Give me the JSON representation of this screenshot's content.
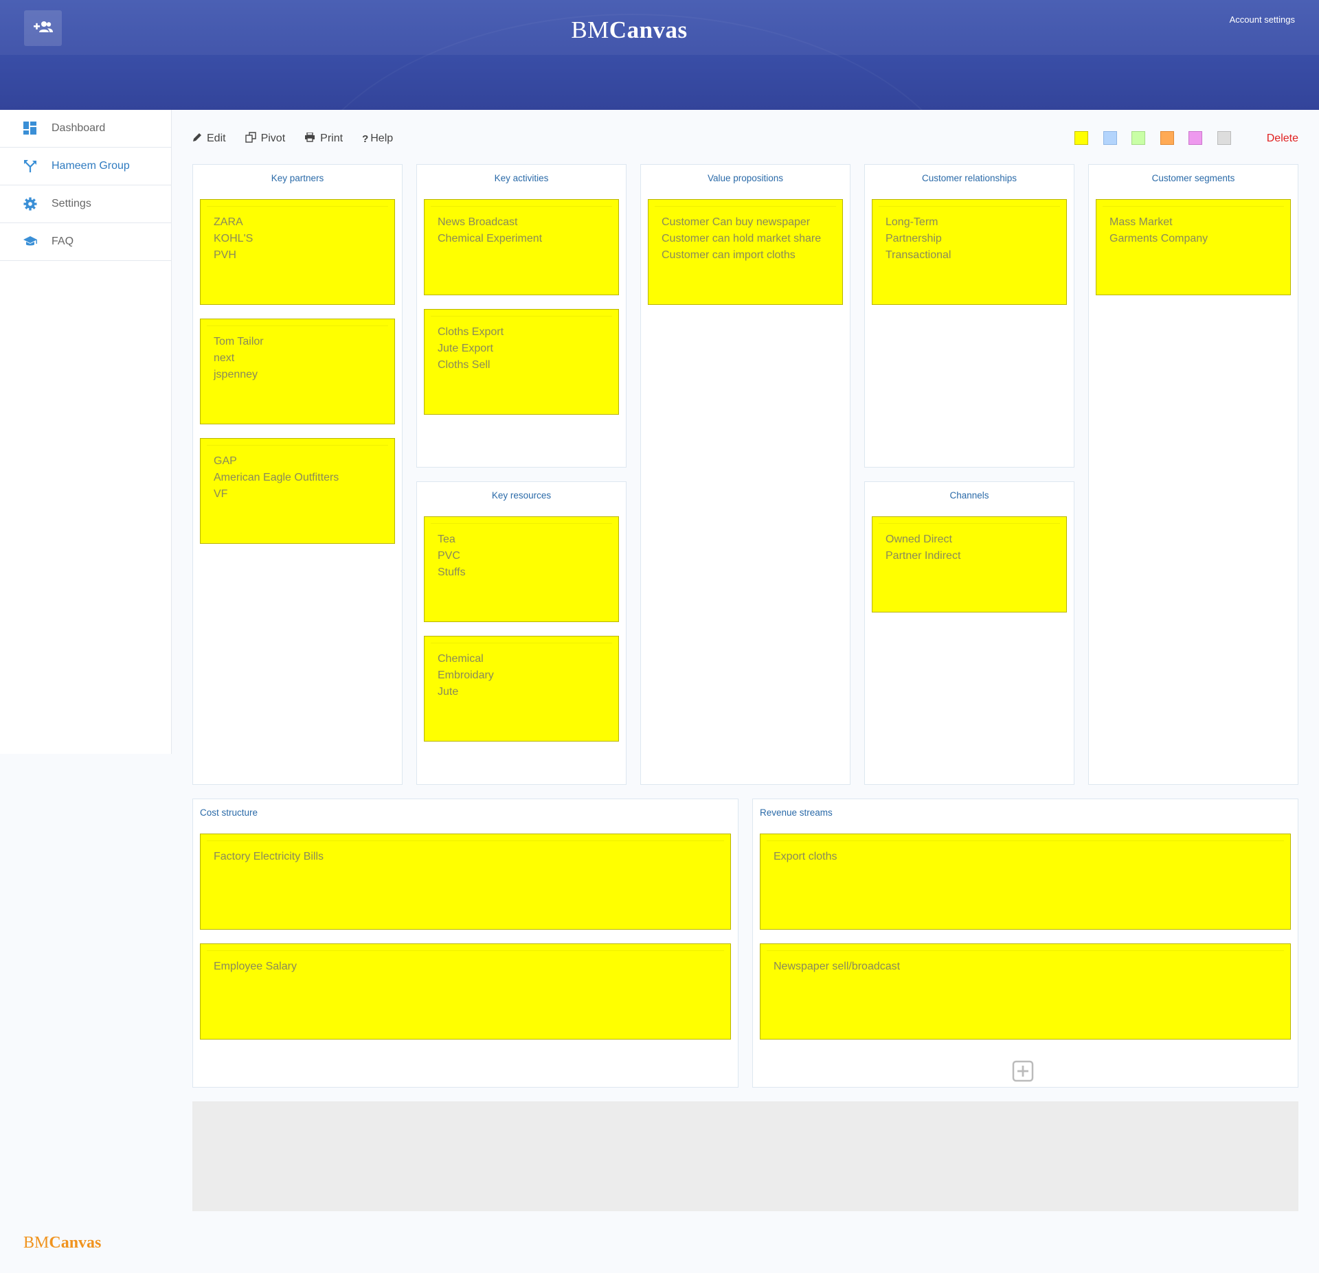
{
  "header": {
    "brand_prefix": "BM",
    "brand_suffix": "Canvas",
    "account_settings": "Account settings",
    "invite_icon": "add-user-icon"
  },
  "sidebar": {
    "items": [
      {
        "label": "Dashboard",
        "icon": "dashboard-icon",
        "active": false
      },
      {
        "label": "Hameem Group",
        "icon": "branch-icon",
        "active": true
      },
      {
        "label": "Settings",
        "icon": "gear-icon",
        "active": false
      },
      {
        "label": "FAQ",
        "icon": "graduation-cap-icon",
        "active": false
      }
    ]
  },
  "toolbar": {
    "edit": "Edit",
    "pivot": "Pivot",
    "print": "Print",
    "help": "Help",
    "delete": "Delete",
    "colors": [
      "#ffff00",
      "#b3d4fc",
      "#c9ffa6",
      "#ffaa55",
      "#ee99ee",
      "#dddddd"
    ]
  },
  "canvas": {
    "key_partners": {
      "title": "Key partners",
      "notes": [
        [
          "ZARA",
          "KOHL'S",
          "PVH"
        ],
        [
          "Tom Tailor",
          "next",
          "jspenney"
        ],
        [
          "GAP",
          "American Eagle Outfitters",
          "VF"
        ]
      ]
    },
    "key_activities": {
      "title": "Key activities",
      "notes": [
        [
          "News Broadcast",
          "Chemical Experiment"
        ],
        [
          "Cloths Export",
          "Jute Export",
          "Cloths Sell"
        ]
      ]
    },
    "key_resources": {
      "title": "Key resources",
      "notes": [
        [
          "Tea",
          "PVC",
          "Stuffs"
        ],
        [
          "Chemical",
          "Embroidary",
          "Jute"
        ]
      ]
    },
    "value_propositions": {
      "title": "Value propositions",
      "notes": [
        [
          "Customer Can buy newspaper",
          "Customer can hold market share",
          "Customer can import cloths"
        ]
      ]
    },
    "customer_relationships": {
      "title": "Customer relationships",
      "notes": [
        [
          "Long-Term",
          "Partnership",
          "Transactional"
        ]
      ]
    },
    "channels": {
      "title": "Channels",
      "notes": [
        [
          "Owned Direct",
          "Partner Indirect"
        ]
      ]
    },
    "customer_segments": {
      "title": "Customer segments",
      "notes": [
        [
          "Mass Market",
          "Garments Company"
        ]
      ]
    },
    "cost_structure": {
      "title": "Cost structure",
      "notes": [
        [
          "Factory Electricity Bills"
        ],
        [
          "Employee Salary"
        ]
      ]
    },
    "revenue_streams": {
      "title": "Revenue streams",
      "notes": [
        [
          "Export cloths"
        ],
        [
          "Newspaper sell/broadcast"
        ]
      ]
    }
  },
  "footer": {
    "brand_prefix": "BM",
    "brand_suffix": "Canvas"
  }
}
